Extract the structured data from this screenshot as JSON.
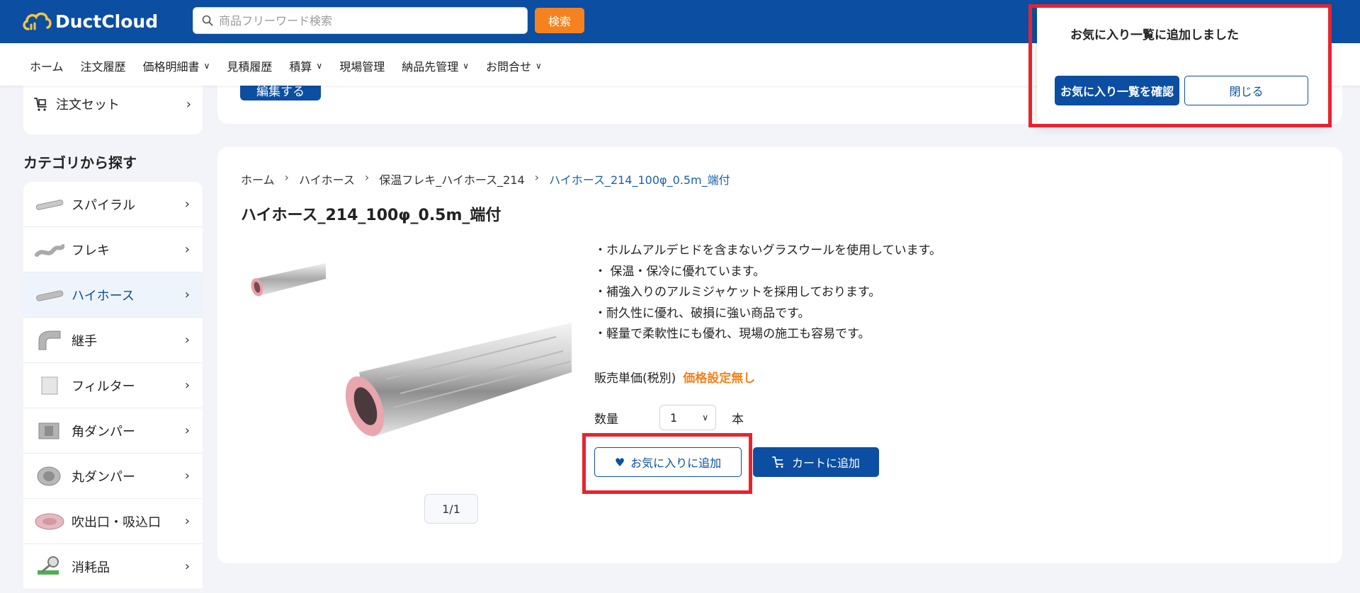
{
  "header": {
    "logo_text": "DuctCloud",
    "search_placeholder": "商品フリーワード検索",
    "search_button": "検索",
    "brand_color": "#0b4ea2",
    "accent_color": "#f5821f"
  },
  "nav": {
    "items": [
      {
        "label": "ホーム",
        "has_dropdown": false
      },
      {
        "label": "注文履歴",
        "has_dropdown": false
      },
      {
        "label": "価格明細書",
        "has_dropdown": true
      },
      {
        "label": "見積履歴",
        "has_dropdown": false
      },
      {
        "label": "積算",
        "has_dropdown": true
      },
      {
        "label": "現場管理",
        "has_dropdown": false
      },
      {
        "label": "納品先管理",
        "has_dropdown": true
      },
      {
        "label": "お問合せ",
        "has_dropdown": true
      }
    ]
  },
  "sidebar": {
    "top_items": [
      {
        "label": "注文セット",
        "icon": "cart-set-icon"
      }
    ],
    "category_heading": "カテゴリから探す",
    "categories": [
      {
        "label": "スパイラル",
        "icon": "spiral-duct-thumb",
        "active": false
      },
      {
        "label": "フレキ",
        "icon": "flex-duct-thumb",
        "active": false
      },
      {
        "label": "ハイホース",
        "icon": "hi-hose-thumb",
        "active": true
      },
      {
        "label": "継手",
        "icon": "fitting-thumb",
        "active": false
      },
      {
        "label": "フィルター",
        "icon": "filter-thumb",
        "active": false
      },
      {
        "label": "角ダンパー",
        "icon": "square-damper-thumb",
        "active": false
      },
      {
        "label": "丸ダンパー",
        "icon": "round-damper-thumb",
        "active": false
      },
      {
        "label": "吹出口・吸込口",
        "icon": "diffuser-thumb",
        "active": false
      },
      {
        "label": "消耗品",
        "icon": "consumables-thumb",
        "active": false
      }
    ]
  },
  "main_top": {
    "edit_button": "編集する"
  },
  "product": {
    "breadcrumb": [
      "ホーム",
      "ハイホース",
      "保温フレキ_ハイホース_214",
      "ハイホース_214_100φ_0.5m_端付"
    ],
    "title": "ハイホース_214_100φ_0.5m_端付",
    "features": [
      "・ホルムアルデヒドを含まないグラスウールを使用しています。",
      "・ 保温・保冷に優れています。",
      "・補強入りのアルミジャケットを採用しております。",
      "・耐久性に優れ、破損に強い商品です。",
      "・軽量で柔軟性にも優れ、現場の施工も容易です。"
    ],
    "price_label": "販売単価(税別)",
    "price_value": "価格設定無し",
    "qty_label": "数量",
    "qty_value": "1",
    "qty_unit": "本",
    "fav_button": "お気に入りに追加",
    "cart_button": "カートに追加",
    "image_pager": "1/1"
  },
  "popup": {
    "message": "お気に入り一覧に追加しました",
    "confirm_button": "お気に入り一覧を確認",
    "close_button": "閉じる"
  }
}
